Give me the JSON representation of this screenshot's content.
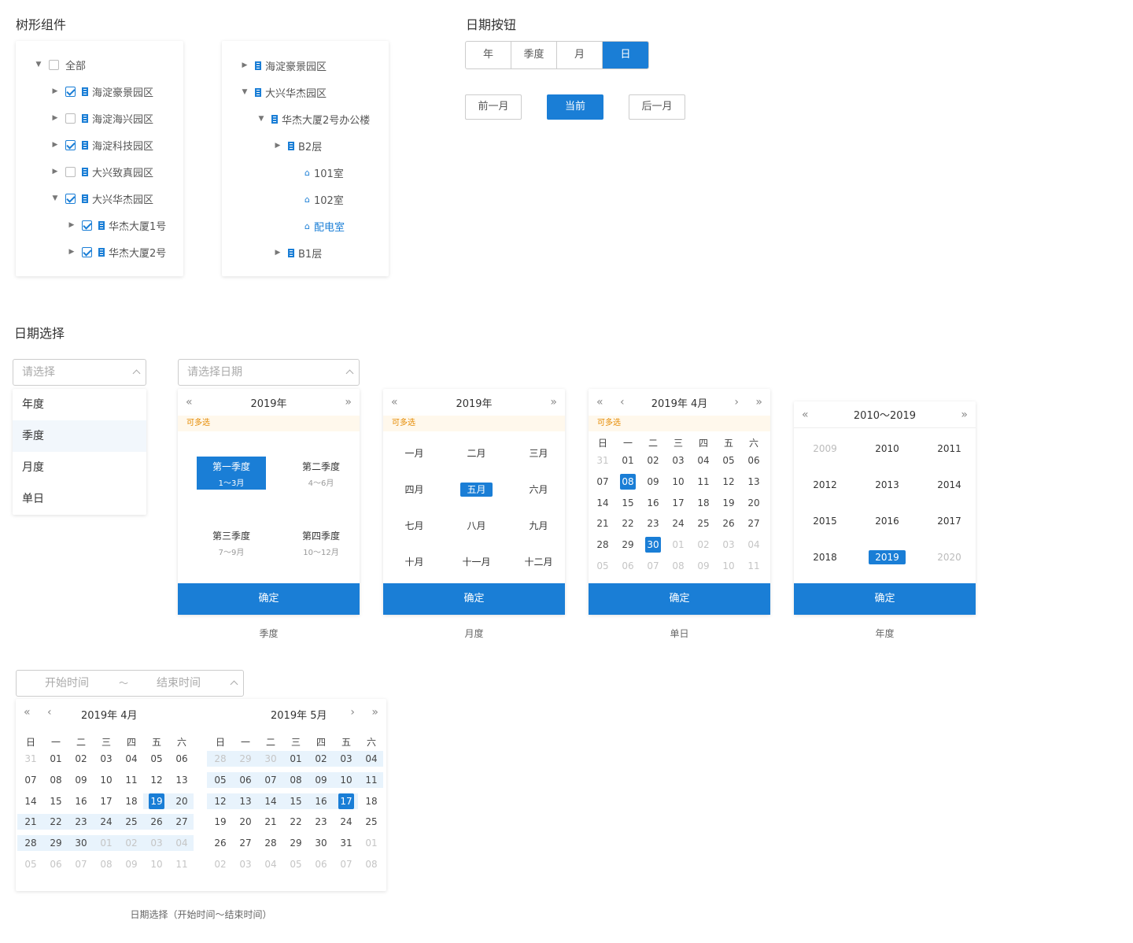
{
  "sections": {
    "tree": "树形组件",
    "date_buttons": "日期按钮",
    "date_picker": "日期选择"
  },
  "tree1": [
    {
      "label": "全部",
      "depth": 0,
      "arrow": "down",
      "checked": false,
      "icon": "none"
    },
    {
      "label": "海淀豪景园区",
      "depth": 1,
      "arrow": "right",
      "checked": true,
      "icon": "building"
    },
    {
      "label": "海淀海兴园区",
      "depth": 1,
      "arrow": "right",
      "checked": false,
      "icon": "building"
    },
    {
      "label": "海淀科技园区",
      "depth": 1,
      "arrow": "right",
      "checked": true,
      "icon": "building"
    },
    {
      "label": "大兴致真园区",
      "depth": 1,
      "arrow": "right",
      "checked": false,
      "icon": "building"
    },
    {
      "label": "大兴华杰园区",
      "depth": 1,
      "arrow": "down",
      "checked": true,
      "icon": "building"
    },
    {
      "label": "华杰大厦1号",
      "depth": 2,
      "arrow": "right",
      "checked": true,
      "icon": "building"
    },
    {
      "label": "华杰大厦2号",
      "depth": 2,
      "arrow": "right",
      "checked": true,
      "icon": "building"
    }
  ],
  "tree2": [
    {
      "label": "海淀豪景园区",
      "depth": 0,
      "arrow": "right",
      "icon": "building"
    },
    {
      "label": "大兴华杰园区",
      "depth": 0,
      "arrow": "down",
      "icon": "building"
    },
    {
      "label": "华杰大厦2号办公楼",
      "depth": 1,
      "arrow": "down",
      "icon": "building"
    },
    {
      "label": "B2层",
      "depth": 2,
      "arrow": "right",
      "icon": "building"
    },
    {
      "label": "101室",
      "depth": 3,
      "arrow": "none",
      "icon": "home"
    },
    {
      "label": "102室",
      "depth": 3,
      "arrow": "none",
      "icon": "home"
    },
    {
      "label": "配电室",
      "depth": 3,
      "arrow": "none",
      "icon": "home",
      "active": true
    },
    {
      "label": "B1层",
      "depth": 2,
      "arrow": "right",
      "icon": "building"
    }
  ],
  "segment": {
    "items": [
      "年",
      "季度",
      "月",
      "日"
    ],
    "selected": "日"
  },
  "period_buttons": {
    "prev": "前一月",
    "current": "当前",
    "next": "后一月"
  },
  "select1": {
    "placeholder": "请选择",
    "options": [
      "年度",
      "季度",
      "月度",
      "单日"
    ],
    "hovered": "季度"
  },
  "select2": {
    "placeholder": "请选择日期"
  },
  "multi_tip": "可多选",
  "ok_label": "确定",
  "quarter_picker": {
    "title": "2019年",
    "caption": "季度",
    "quarters": [
      {
        "name": "第一季度",
        "range": "1～3月",
        "selected": true
      },
      {
        "name": "第二季度",
        "range": "4～6月",
        "selected": false
      },
      {
        "name": "第三季度",
        "range": "7～9月",
        "selected": false
      },
      {
        "name": "第四季度",
        "range": "10～12月",
        "selected": false
      }
    ]
  },
  "month_picker": {
    "title": "2019年",
    "caption": "月度",
    "months": [
      "一月",
      "二月",
      "三月",
      "四月",
      "五月",
      "六月",
      "七月",
      "八月",
      "九月",
      "十月",
      "十一月",
      "十二月"
    ],
    "selected": "五月"
  },
  "day_picker": {
    "title": "2019年  4月",
    "caption": "单日",
    "weekdays": [
      "日",
      "一",
      "二",
      "三",
      "四",
      "五",
      "六"
    ],
    "days": [
      "31",
      "01",
      "02",
      "03",
      "04",
      "05",
      "06",
      "07",
      "08",
      "09",
      "10",
      "11",
      "12",
      "13",
      "14",
      "15",
      "16",
      "17",
      "18",
      "19",
      "20",
      "21",
      "22",
      "23",
      "24",
      "25",
      "26",
      "27",
      "28",
      "29",
      "30",
      "01",
      "02",
      "03",
      "04",
      "05",
      "06",
      "07",
      "08",
      "09",
      "10",
      "11"
    ],
    "gray_before": 1,
    "gray_after_index": 31,
    "selected": [
      "08",
      "30"
    ]
  },
  "year_picker": {
    "title": "2010～2019",
    "caption": "年度",
    "years": [
      "2009",
      "2010",
      "2011",
      "2012",
      "2013",
      "2014",
      "2015",
      "2016",
      "2017",
      "2018",
      "2019",
      "2020"
    ],
    "selected": "2019"
  },
  "range_input": {
    "start": "开始时间",
    "sep": "～",
    "end": "结束时间"
  },
  "range_picker": {
    "left": {
      "title": "2019年  4月",
      "days": [
        "31",
        "01",
        "02",
        "03",
        "04",
        "05",
        "06",
        "07",
        "08",
        "09",
        "10",
        "11",
        "12",
        "13",
        "14",
        "15",
        "16",
        "17",
        "18",
        "19",
        "20",
        "21",
        "22",
        "23",
        "24",
        "25",
        "26",
        "27",
        "28",
        "29",
        "30",
        "01",
        "02",
        "03",
        "04",
        "05",
        "06",
        "07",
        "08",
        "09",
        "10",
        "11"
      ],
      "first": 1,
      "last": 30,
      "selected": "19"
    },
    "right": {
      "title": "2019年  5月",
      "days": [
        "28",
        "29",
        "30",
        "01",
        "02",
        "03",
        "04",
        "05",
        "06",
        "07",
        "08",
        "09",
        "10",
        "11",
        "12",
        "13",
        "14",
        "15",
        "16",
        "17",
        "18",
        "19",
        "20",
        "21",
        "22",
        "23",
        "24",
        "25",
        "26",
        "27",
        "28",
        "29",
        "30",
        "31",
        "01",
        "02",
        "03",
        "04",
        "05",
        "06",
        "07",
        "08"
      ],
      "first": 3,
      "last": 33,
      "selected": "17"
    },
    "caption": "日期选择（开始时间～结束时间）"
  }
}
